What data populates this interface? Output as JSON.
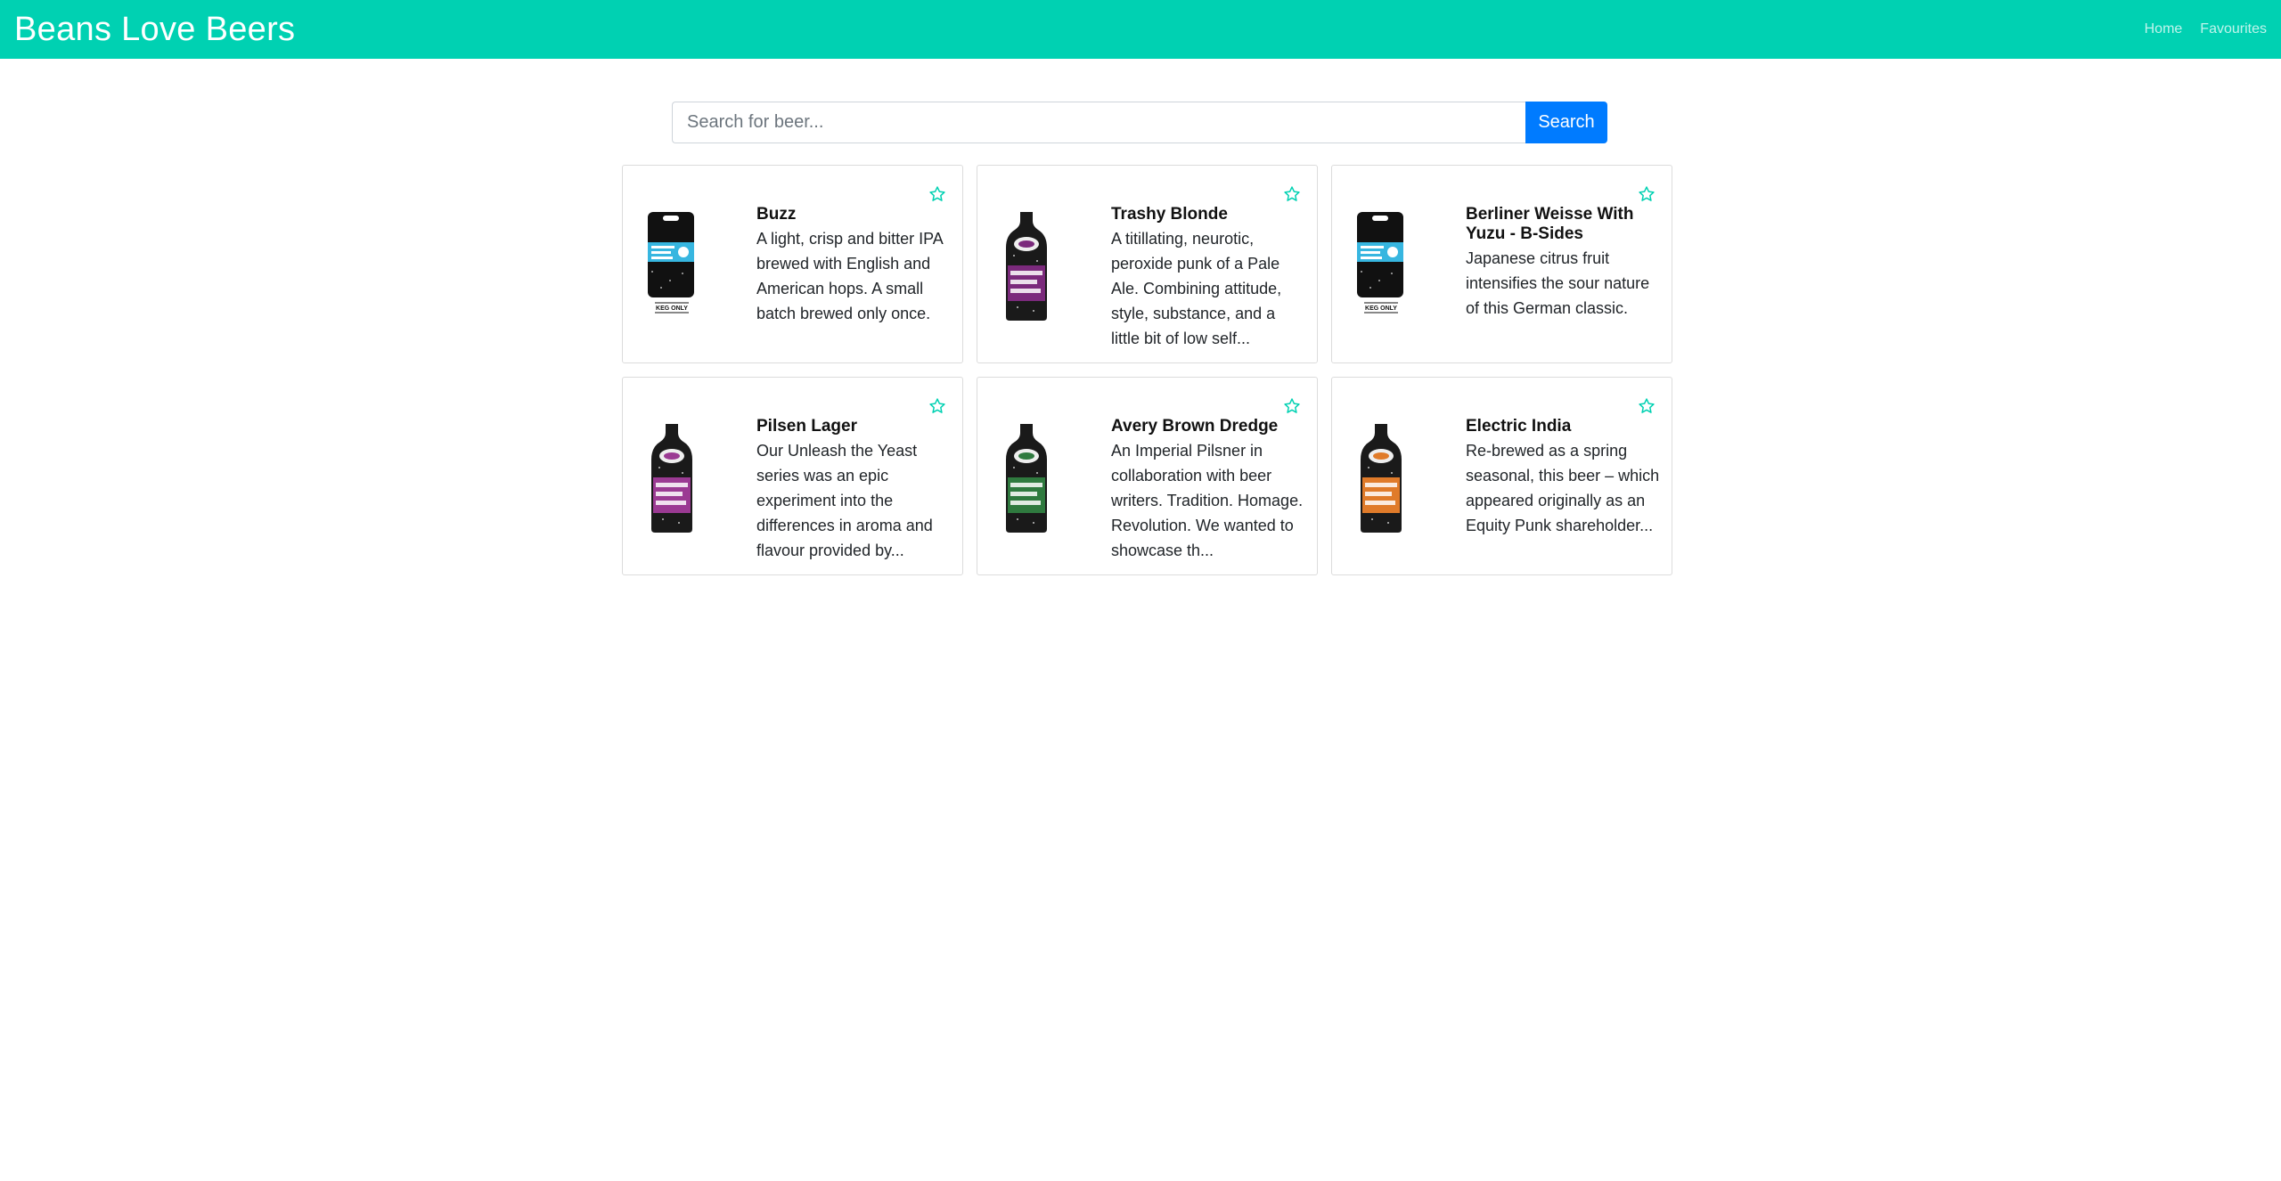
{
  "navbar": {
    "brand": "Beans Love Beers",
    "links": [
      "Home",
      "Favourites"
    ],
    "color": "#00d1b2"
  },
  "search": {
    "placeholder": "Search for beer...",
    "value": "",
    "button_label": "Search",
    "button_color": "#007bff"
  },
  "beers": [
    {
      "name": "Buzz",
      "description": "A light, crisp and bitter IPA brewed with English and American hops. A small batch brewed only once.",
      "image": "keg-bottle-blue",
      "image_caption": "KEG ONLY",
      "label_color": "#37b6e0"
    },
    {
      "name": "Trashy Blonde",
      "description": "A titillating, neurotic, peroxide punk of a Pale Ale. Combining attitude, style, substance, and a little bit of low self...",
      "image": "bottle-purple",
      "label_color": "#7b2a7c"
    },
    {
      "name": "Berliner Weisse With Yuzu - B-Sides",
      "description": "Japanese citrus fruit intensifies the sour nature of this German classic.",
      "image": "keg-bottle-blue",
      "image_caption": "KEG ONLY",
      "label_color": "#37b6e0"
    },
    {
      "name": "Pilsen Lager",
      "description": "Our Unleash the Yeast series was an epic experiment into the differences in aroma and flavour provided by...",
      "image": "bottle-purple",
      "label_color": "#9b3a93"
    },
    {
      "name": "Avery Brown Dredge",
      "description": "An Imperial Pilsner in collaboration with beer writers. Tradition. Homage. Revolution. We wanted to showcase th...",
      "image": "bottle-green",
      "label_color": "#2f7a3f"
    },
    {
      "name": "Electric India",
      "description": "Re-brewed as a spring seasonal, this beer – which appeared originally as an Equity Punk shareholder...",
      "image": "bottle-orange",
      "label_color": "#e07b2a"
    }
  ]
}
